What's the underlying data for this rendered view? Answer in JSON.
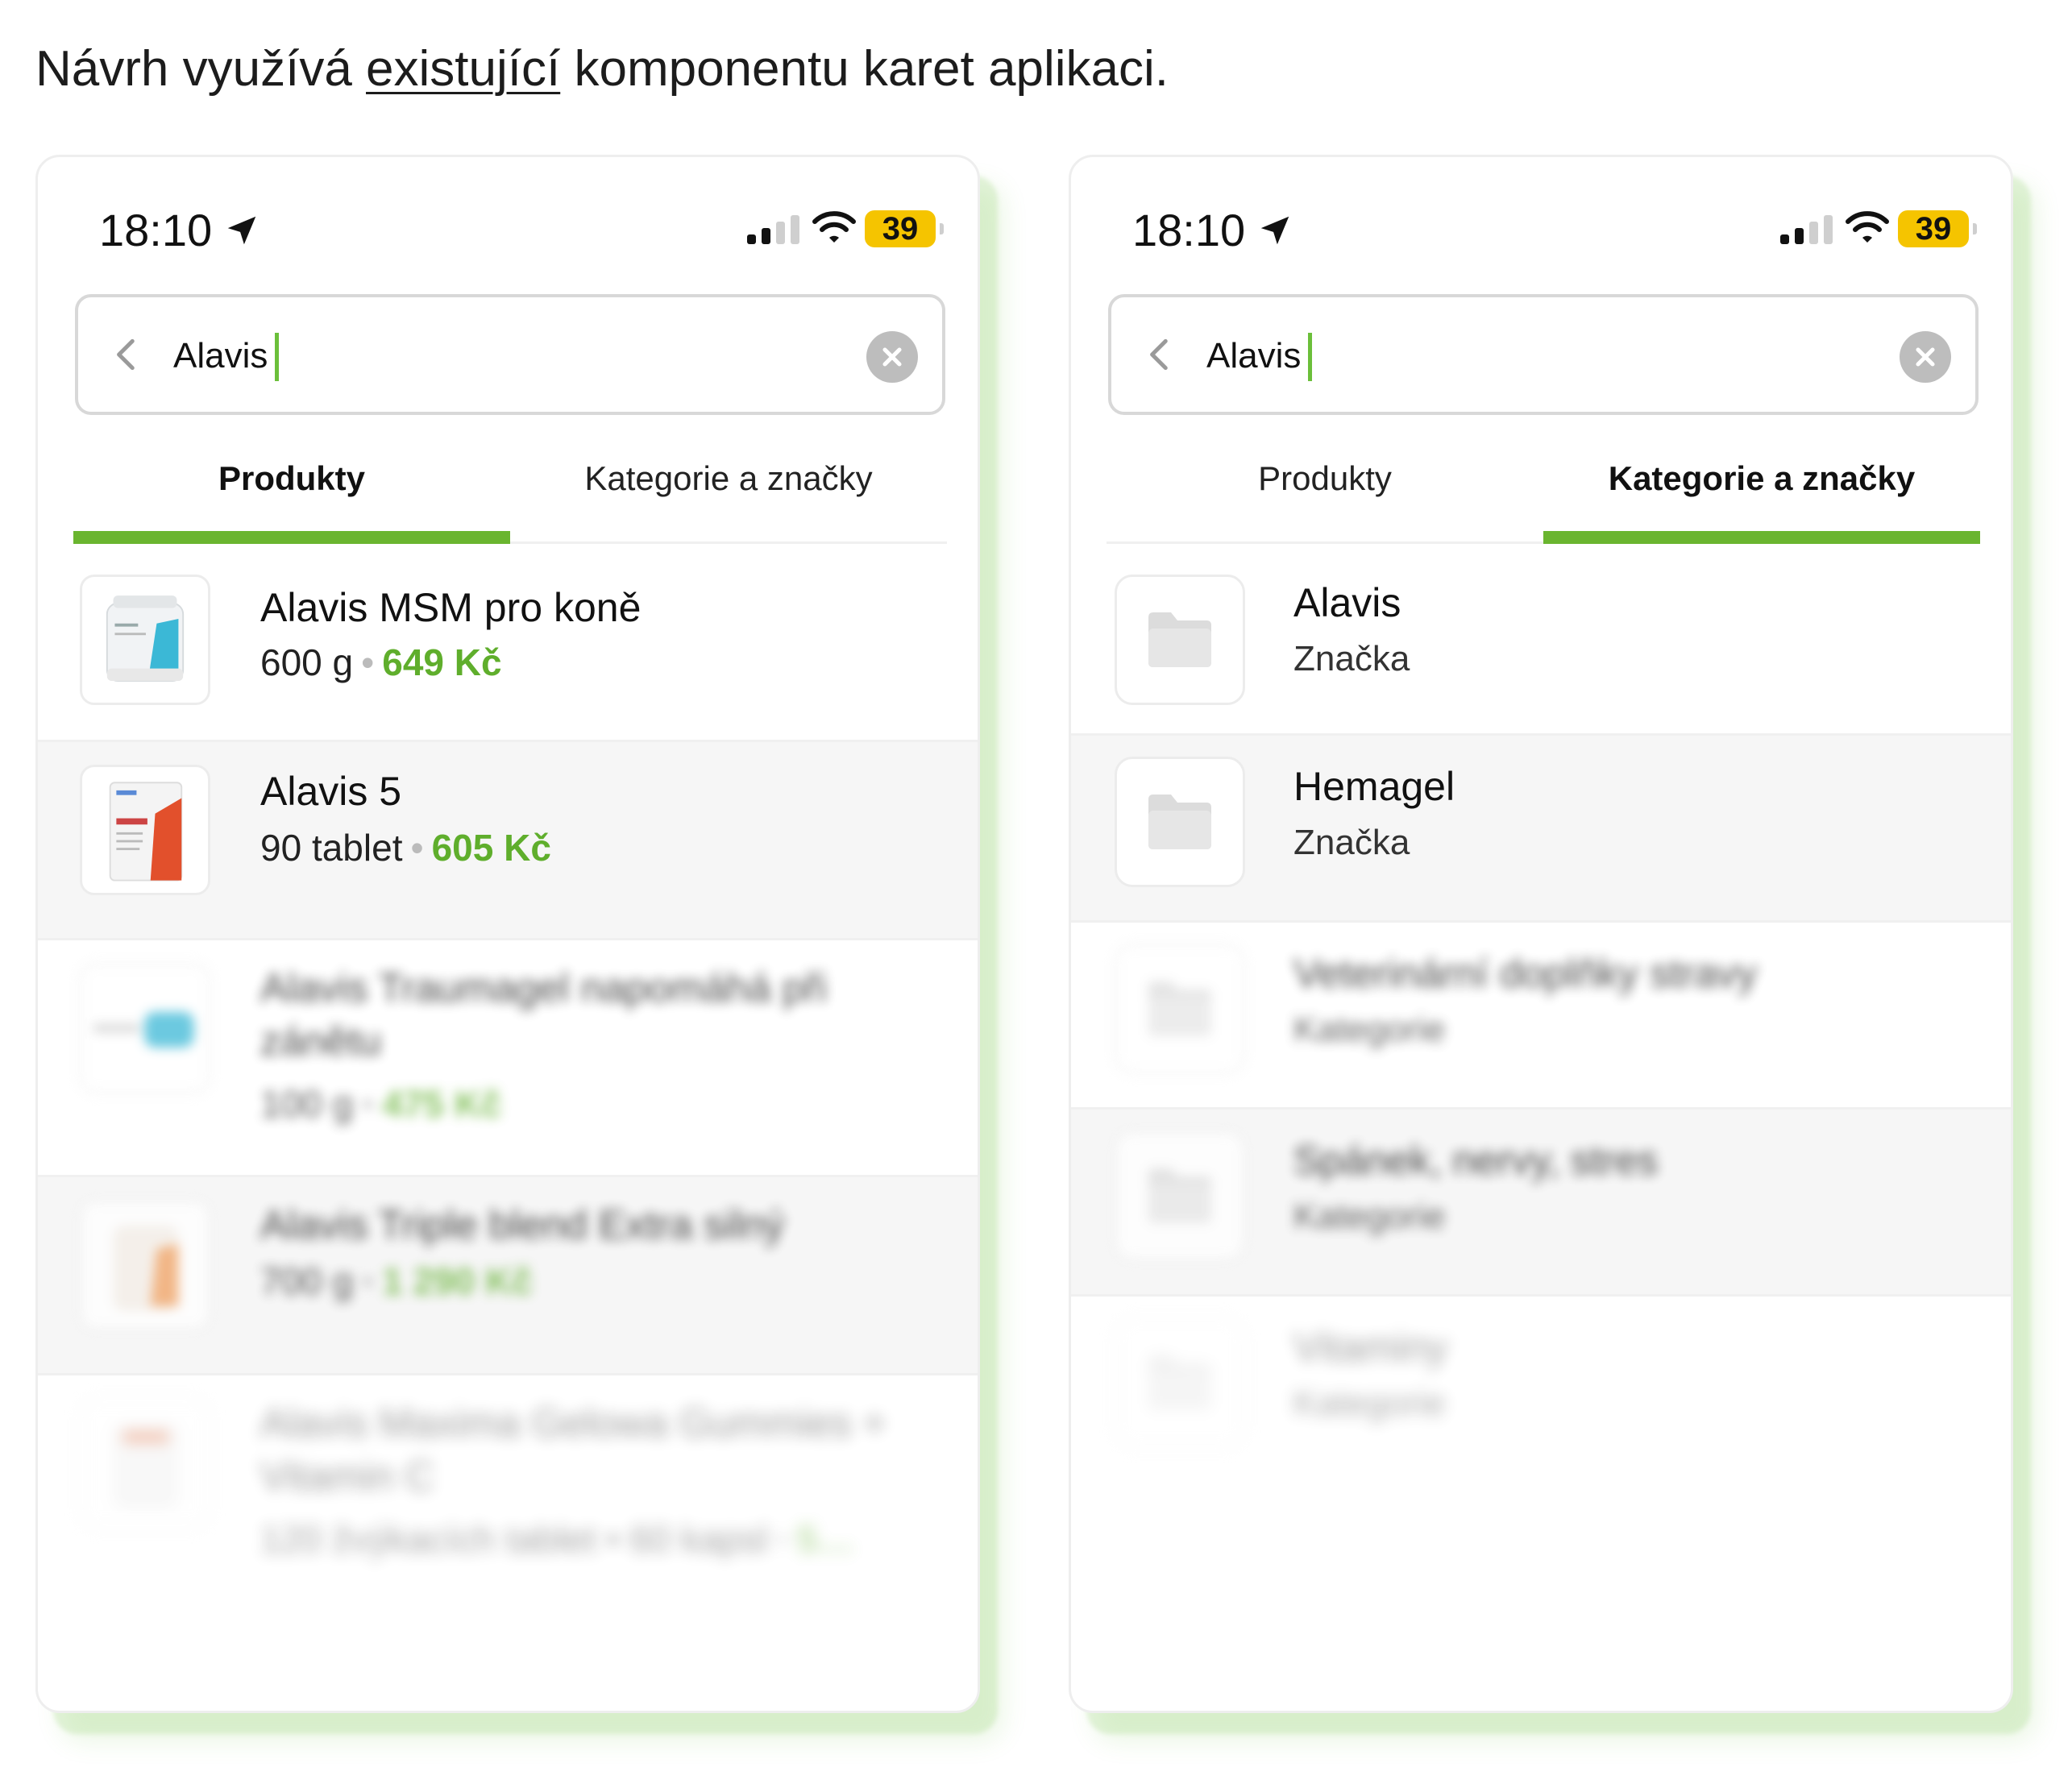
{
  "intro": {
    "before": "Návrh využívá ",
    "underlined": "existující",
    "after": " komponentu karet aplikaci."
  },
  "colors": {
    "accent_green": "#6ab52f",
    "price_green": "#5fae2c",
    "battery_yellow": "#f5c400"
  },
  "status_bar": {
    "time": "18:10",
    "battery": "39"
  },
  "search": {
    "value": "Alavis"
  },
  "tabs": {
    "products": "Produkty",
    "categories": "Kategorie a značky"
  },
  "left_screen": {
    "active_tab": "products",
    "products": [
      {
        "name": "Alavis MSM pro koně",
        "size": "600 g",
        "price": "649 Kč"
      },
      {
        "name": "Alavis 5",
        "size": "90 tablet",
        "price": "605 Kč"
      },
      {
        "name": "Alavis Traumagel napomáhá při zánětu",
        "size": "100 g",
        "price": "475 Kč"
      },
      {
        "name": "Alavis Triple blend Extra silný",
        "size": "700 g",
        "price": "1 290 Kč"
      },
      {
        "name": "Alavis Maxima Gelowa Gummies + Vitamin C",
        "size": "120 žvýkacích tablet • 60 kapsl",
        "price": "5…"
      }
    ]
  },
  "right_screen": {
    "active_tab": "categories",
    "items": [
      {
        "name": "Alavis",
        "type": "Značka"
      },
      {
        "name": "Hemagel",
        "type": "Značka"
      },
      {
        "name": "Veterinární doplňky stravy",
        "type": "Kategorie"
      },
      {
        "name": "Spánek, nervy, stres",
        "type": "Kategorie"
      },
      {
        "name": "Vitaminy",
        "type": "Kategorie"
      }
    ]
  },
  "icons": {
    "location": "location-arrow-icon",
    "signal": "signal-icon",
    "wifi": "wifi-icon",
    "back": "chevron-left-icon",
    "clear": "clear-icon",
    "folder": "folder-icon"
  }
}
